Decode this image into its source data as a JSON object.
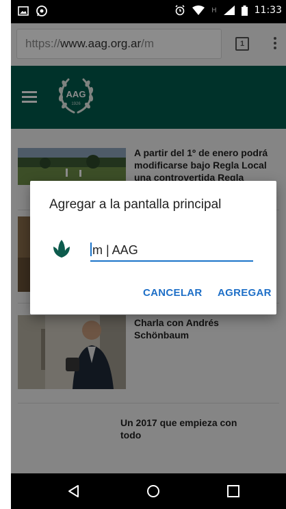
{
  "status_bar": {
    "time": "11:33",
    "network": "H"
  },
  "browser": {
    "url_scheme": "https://",
    "url_host": "www.aag.org.ar",
    "url_path": "/m",
    "tab_count": "1"
  },
  "site_header": {
    "logo_text": "AAG",
    "logo_year": "1926"
  },
  "articles": [
    {
      "title": "A partir del 1º de enero podrá modificarse bajo Regla Local una controvertida Regla"
    },
    {
      "title": "Charla con Andrés Schönbaum"
    },
    {
      "title": "Un 2017 que empieza con todo"
    }
  ],
  "dialog": {
    "title": "Agregar a la pantalla principal",
    "input_value": "m | AAG",
    "cancel_label": "CANCELAR",
    "add_label": "AGREGAR"
  },
  "colors": {
    "header_green": "#005b4e",
    "accent_blue": "#1a73c9"
  }
}
